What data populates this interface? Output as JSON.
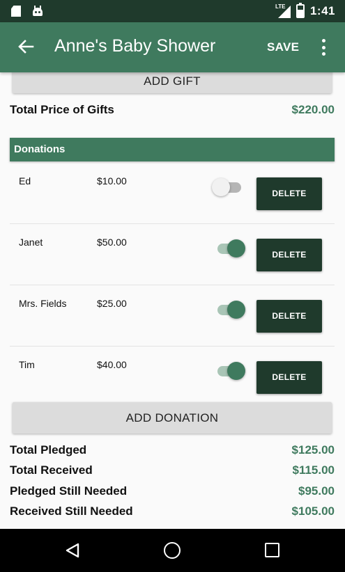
{
  "status_bar": {
    "time": "1:41",
    "network": "LTE",
    "icons": [
      "sd-card-icon",
      "android-icon",
      "signal-icon",
      "battery-icon"
    ]
  },
  "app_bar": {
    "title": "Anne's Baby Shower",
    "save_label": "SAVE",
    "back_icon": "arrow-back-icon",
    "overflow_icon": "more-vert-icon"
  },
  "gifts": {
    "add_button_label": "ADD GIFT",
    "total_label": "Total Price of Gifts",
    "total_value": "$220.00"
  },
  "donations": {
    "header": "Donations",
    "delete_label": "DELETE",
    "items": [
      {
        "name": "Ed",
        "amount": "$10.00",
        "received": false
      },
      {
        "name": "Janet",
        "amount": "$50.00",
        "received": true
      },
      {
        "name": "Mrs. Fields",
        "amount": "$25.00",
        "received": true
      },
      {
        "name": "Tim",
        "amount": "$40.00",
        "received": true
      }
    ],
    "add_button_label": "ADD DONATION"
  },
  "summary": [
    {
      "label": "Total Pledged",
      "value": "$125.00"
    },
    {
      "label": "Total Received",
      "value": "$115.00"
    },
    {
      "label": "Pledged Still Needed",
      "value": "$95.00"
    },
    {
      "label": "Received Still Needed",
      "value": "$105.00"
    }
  ],
  "colors": {
    "status_bar": "#1f3a2c",
    "app_bar": "#3f7a5e",
    "accent": "#3f7a5e",
    "delete_button": "#1f3a2c"
  },
  "nav_bar": {
    "icons": [
      "nav-back-icon",
      "nav-home-icon",
      "nav-recents-icon"
    ]
  }
}
